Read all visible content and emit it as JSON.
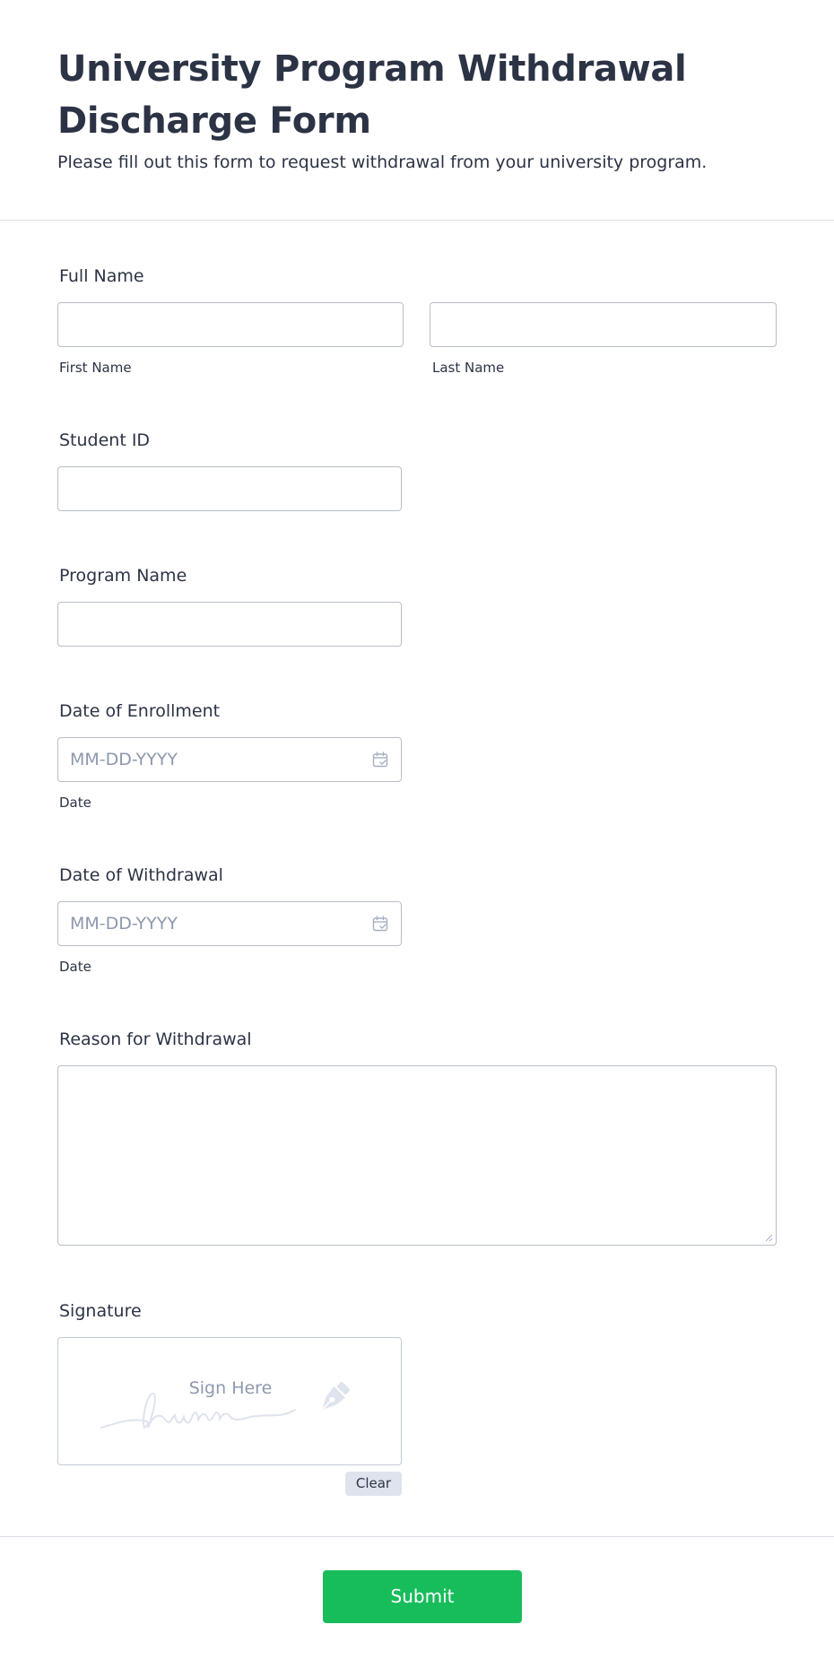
{
  "header": {
    "title": "University Program Withdrawal Discharge Form",
    "subtitle": "Please fill out this form to request withdrawal from your university program."
  },
  "fields": {
    "full_name": {
      "label": "Full Name",
      "first_sublabel": "First Name",
      "last_sublabel": "Last Name",
      "first_value": "",
      "last_value": ""
    },
    "student_id": {
      "label": "Student ID",
      "value": ""
    },
    "program_name": {
      "label": "Program Name",
      "value": ""
    },
    "date_of_enrollment": {
      "label": "Date of Enrollment",
      "placeholder": "MM-DD-YYYY",
      "sublabel": "Date",
      "icon": "calendar-icon"
    },
    "date_of_withdrawal": {
      "label": "Date of Withdrawal",
      "placeholder": "MM-DD-YYYY",
      "sublabel": "Date",
      "icon": "calendar-icon"
    },
    "reason": {
      "label": "Reason for Withdrawal",
      "value": ""
    },
    "signature": {
      "label": "Signature",
      "placeholder": "Sign Here",
      "clear_label": "Clear",
      "icon": "pen-nib-icon"
    }
  },
  "actions": {
    "submit_label": "Submit"
  },
  "colors": {
    "text": "#2c3345",
    "placeholder": "#8d99ad",
    "input_border": "#b8bdc9",
    "submit_bg": "#18bd5b",
    "clear_bg": "#dfe3ed"
  }
}
